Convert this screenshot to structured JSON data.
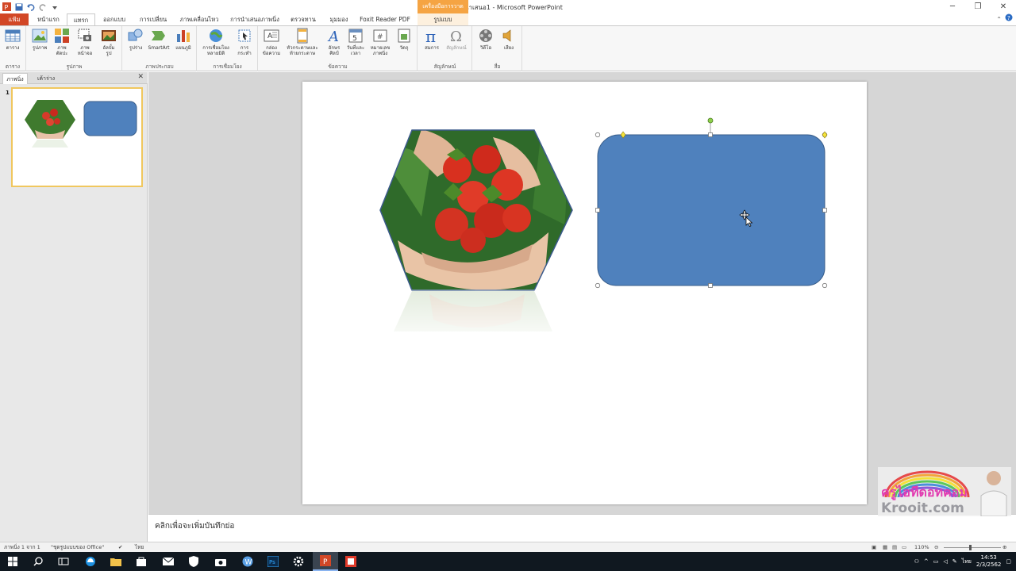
{
  "window": {
    "title": "งานนำเสนอ1 - Microsoft PowerPoint",
    "contextual_group": "เครื่องมือการวาด",
    "controls": [
      "─",
      "❐",
      "✕"
    ]
  },
  "tabs": [
    {
      "label": "แฟ้ม"
    },
    {
      "label": "หน้าแรก"
    },
    {
      "label": "แทรก"
    },
    {
      "label": "ออกแบบ"
    },
    {
      "label": "การเปลี่ยน"
    },
    {
      "label": "ภาพเคลื่อนไหว"
    },
    {
      "label": "การนำเสนอภาพนิ่ง"
    },
    {
      "label": "ตรวจทาน"
    },
    {
      "label": "มุมมอง"
    },
    {
      "label": "Foxit Reader PDF"
    },
    {
      "label": "รูปแบบ"
    }
  ],
  "ribbon": {
    "groups": [
      {
        "label": "ตาราง",
        "buttons": [
          {
            "label": "ตาราง",
            "icon": "table-icon"
          }
        ]
      },
      {
        "label": "รูปภาพ",
        "buttons": [
          {
            "label": "รูปภาพ",
            "icon": "picture-icon"
          },
          {
            "label": "ภาพ\nตัดปะ",
            "icon": "clipart-icon"
          },
          {
            "label": "ภาพ\nหน้าจอ",
            "icon": "screenshot-icon"
          },
          {
            "label": "อัลบั้ม\nรูป",
            "icon": "album-icon"
          }
        ]
      },
      {
        "label": "ภาพประกอบ",
        "buttons": [
          {
            "label": "รูปร่าง",
            "icon": "shapes-icon"
          },
          {
            "label": "SmartArt",
            "icon": "smartart-icon"
          },
          {
            "label": "แผนภูมิ",
            "icon": "chart-icon"
          }
        ]
      },
      {
        "label": "การเชื่อมโยง",
        "buttons": [
          {
            "label": "การเชื่อมโยง\nหลายมิติ",
            "icon": "hyperlink-icon"
          },
          {
            "label": "การ\nกระทำ",
            "icon": "action-icon"
          }
        ]
      },
      {
        "label": "ข้อความ",
        "buttons": [
          {
            "label": "กล่อง\nข้อความ",
            "icon": "textbox-icon"
          },
          {
            "label": "หัวกระดาษและ\nท้ายกระดาษ",
            "icon": "header-footer-icon"
          },
          {
            "label": "อักษร\nศิลป์",
            "icon": "wordart-icon"
          },
          {
            "label": "วันที่และ\nเวลา",
            "icon": "date-time-icon"
          },
          {
            "label": "หมายเลข\nภาพนิ่ง",
            "icon": "slide-number-icon"
          },
          {
            "label": "วัตถุ",
            "icon": "object-icon"
          }
        ]
      },
      {
        "label": "สัญลักษณ์",
        "buttons": [
          {
            "label": "สมการ",
            "icon": "equation-icon"
          },
          {
            "label": "สัญลักษณ์",
            "icon": "symbol-icon"
          }
        ]
      },
      {
        "label": "สื่อ",
        "buttons": [
          {
            "label": "วิดีโอ",
            "icon": "video-icon"
          },
          {
            "label": "เสียง",
            "icon": "audio-icon"
          }
        ]
      }
    ]
  },
  "left_pane": {
    "tabs": [
      "ภาพนิ่ง",
      "เค้าร่าง"
    ],
    "slide_number": "1"
  },
  "notes": {
    "placeholder": "คลิกเพื่อจะเพิ่มบันทึกย่อ"
  },
  "status_bar": {
    "slide_info": "ภาพนิ่ง 1 จาก 1",
    "theme": "\"ชุดรูปแบบของ Office\"",
    "language": "ไทย",
    "zoom": "110%"
  },
  "taskbar": {
    "time": "14:53",
    "date": "2/3/2562",
    "ime": "ไทย"
  },
  "watermark": {
    "text_pink": "ครูไอทีดอทคอม",
    "text_gray": "Krooit.com"
  },
  "colors": {
    "file_tab": "#d24726",
    "contextual": "#f5a443",
    "shape_fill": "#4f81bd",
    "shape_stroke": "#385d8a"
  }
}
